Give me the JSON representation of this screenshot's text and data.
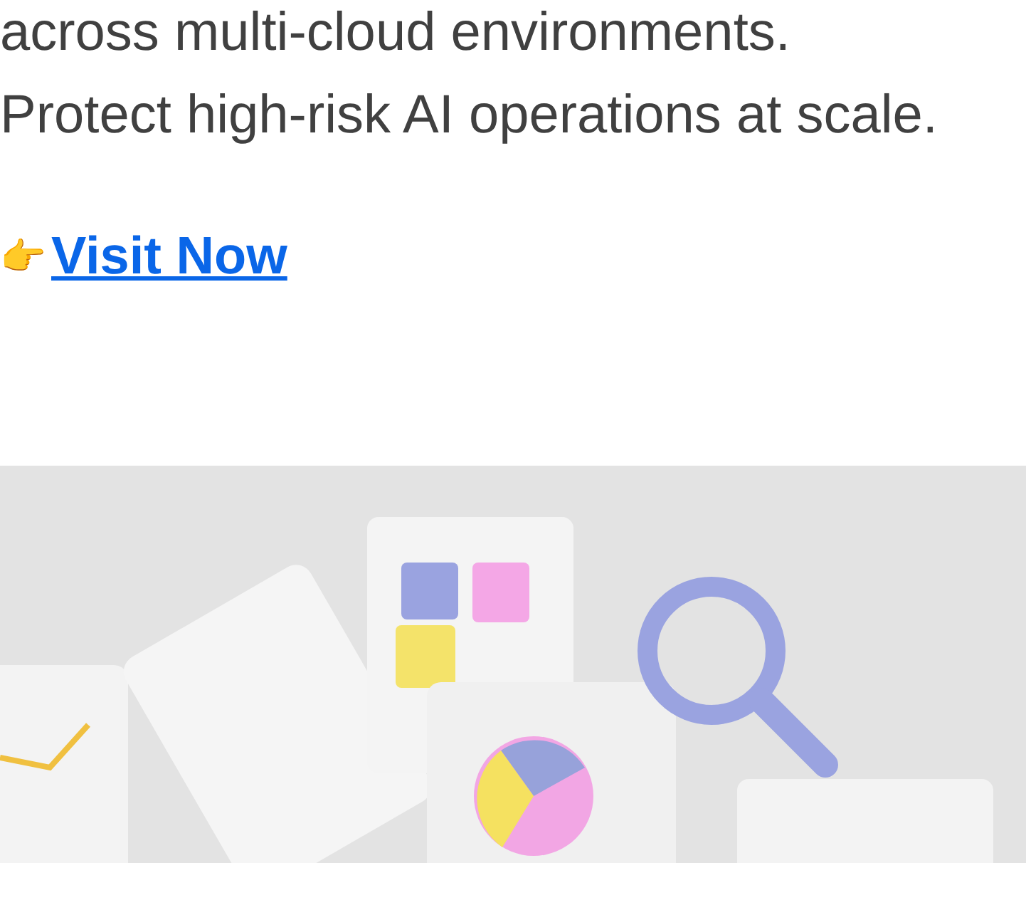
{
  "paragraph_lines": [
    "across multi-cloud environments.",
    "Protect high-risk AI operations at scale."
  ],
  "link": {
    "emoji": "👉",
    "label": "Visit Now"
  }
}
